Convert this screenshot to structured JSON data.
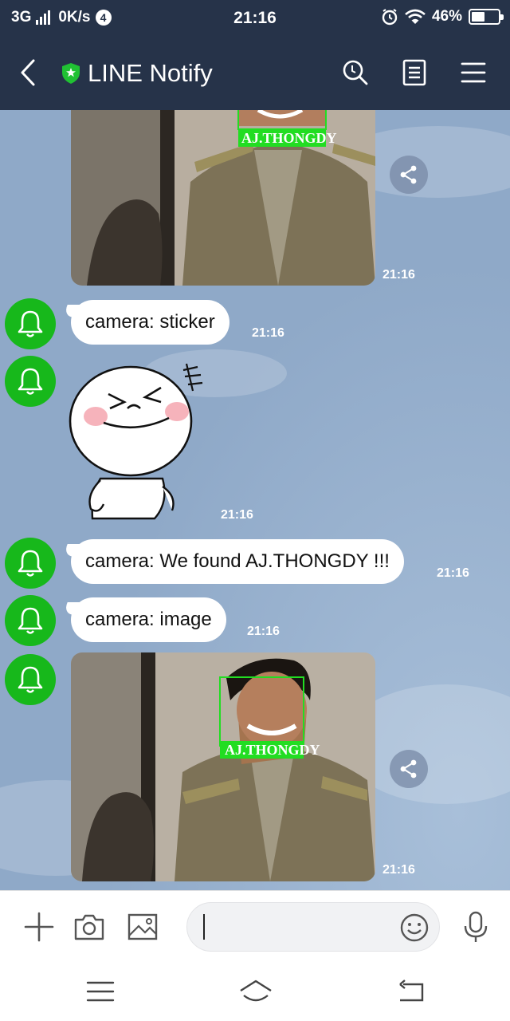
{
  "status_bar": {
    "network": "3G",
    "speed": "0K/s",
    "notification_count": "4",
    "time": "21:16",
    "battery": "46%",
    "icons": [
      "signal-icon",
      "alarm-icon",
      "wifi-icon",
      "battery-icon"
    ]
  },
  "header": {
    "title": "LINE Notify",
    "icons": [
      "back-icon",
      "official-shield-icon",
      "search-icon",
      "notes-icon",
      "menu-icon"
    ]
  },
  "messages": [
    {
      "type": "image",
      "label": "AJ.THONGDY",
      "time": "21:16"
    },
    {
      "type": "text",
      "text": "camera: sticker",
      "time": "21:16"
    },
    {
      "type": "sticker",
      "time": "21:16"
    },
    {
      "type": "text",
      "text": "camera: We found AJ.THONGDY !!!",
      "time": "21:16"
    },
    {
      "type": "text",
      "text": "camera: image",
      "time": "21:16"
    },
    {
      "type": "image",
      "label": "AJ.THONGDY",
      "time": "21:16"
    }
  ],
  "input_bar": {
    "placeholder": "",
    "icons": [
      "plus-icon",
      "camera-icon",
      "gallery-icon",
      "emoji-icon",
      "microphone-icon"
    ]
  },
  "nav_bar": {
    "icons": [
      "recent-apps-icon",
      "home-icon",
      "back-nav-icon"
    ]
  },
  "colors": {
    "header_bg": "#263349",
    "chat_bg": "#8fa9c8",
    "avatar_green": "#17b81b",
    "face_box_green": "#22dd22"
  }
}
